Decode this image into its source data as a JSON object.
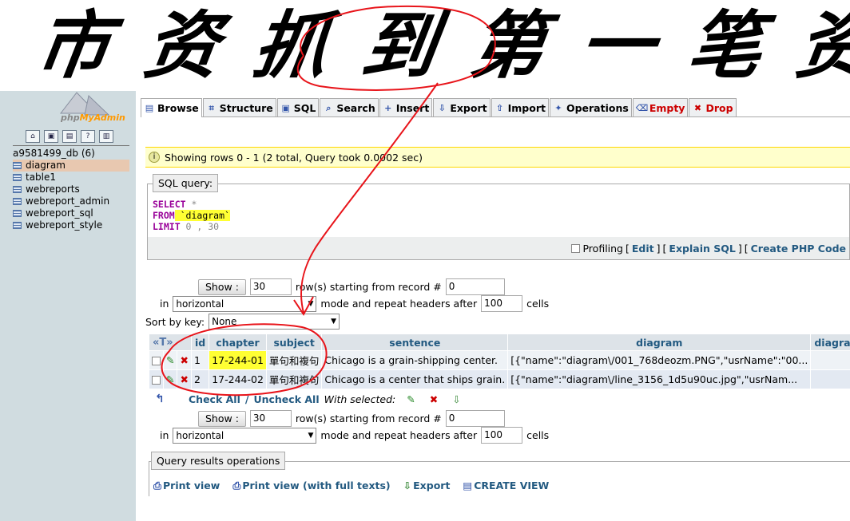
{
  "banner": {
    "handwriting": "市 资 抓 到 第 一 笔 资 料"
  },
  "sidebar": {
    "logo": {
      "part1": "php",
      "part2": "MyAdmin"
    },
    "icons": [
      "home-icon",
      "lock-icon",
      "sql-icon",
      "help-icon",
      "docs-icon"
    ],
    "db": "a9581499_db (6)",
    "tables": [
      "diagram",
      "table1",
      "webreports",
      "webreport_admin",
      "webreport_sql",
      "webreport_style"
    ],
    "active_table": "diagram"
  },
  "tabs": [
    {
      "label": "Browse",
      "icon": "▤"
    },
    {
      "label": "Structure",
      "icon": "⌗"
    },
    {
      "label": "SQL",
      "icon": "▣"
    },
    {
      "label": "Search",
      "icon": "⌕"
    },
    {
      "label": "Insert",
      "icon": "+"
    },
    {
      "label": "Export",
      "icon": "⇩"
    },
    {
      "label": "Import",
      "icon": "⇧"
    },
    {
      "label": "Operations",
      "icon": "✦"
    },
    {
      "label": "Empty",
      "icon": "⌫"
    },
    {
      "label": "Drop",
      "icon": "✖"
    }
  ],
  "notice": "Showing rows 0 - 1 (2 total, Query took 0.0002 sec)",
  "sql_box": {
    "legend": "SQL query:",
    "select_kw": "SELECT",
    "star": " *",
    "from_kw": "FROM",
    "table": " `diagram`",
    "limit_kw": "LIMIT",
    "limit_val": " 0 , 30"
  },
  "sql_bar": {
    "profiling": "Profiling",
    "edit": "Edit",
    "explain": "Explain SQL",
    "php": "Create PHP Code"
  },
  "nav_top": {
    "show_btn": "Show :",
    "rows_value": "30",
    "rows_label": "row(s) starting from record #",
    "start_value": "0",
    "in_label": "in",
    "mode_value": "horizontal",
    "mode_label": "mode and repeat headers after",
    "repeat_value": "100",
    "cells_label": "cells"
  },
  "sort": {
    "label": "Sort by key:",
    "value": "None"
  },
  "table": {
    "headers": [
      "id",
      "chapter",
      "subject",
      "sentence",
      "diagram",
      "diagram_xml"
    ],
    "rows": [
      [
        "1",
        "17-244-01",
        "單句和複句",
        "Chicago is a grain-shipping center.",
        "[{\"name\":\"diagram\\/001_768deozm.PNG\",\"usrName\":\"00...",
        ""
      ],
      [
        "2",
        "17-244-02",
        "單句和複句",
        "Chicago is a center that ships grain.",
        "[{\"name\":\"diagram\\/line_3156_1d5u90uc.jpg\",\"usrNam...",
        ""
      ]
    ]
  },
  "with_selected": {
    "check_all": "Check All",
    "sep": " / ",
    "uncheck_all": "Uncheck All",
    "label": "With selected:"
  },
  "nav_bottom": {
    "show_btn": "Show :",
    "rows_value": "30",
    "rows_label": "row(s) starting from record #",
    "start_value": "0",
    "in_label": "in",
    "mode_value": "horizontal",
    "mode_label": "mode and repeat headers after",
    "repeat_value": "100",
    "cells_label": "cells"
  },
  "qro": {
    "legend": "Query results operations",
    "print": "Print view",
    "print_full": "Print view (with full texts)",
    "export": "Export",
    "create_view": "CREATE VIEW"
  },
  "colors": {
    "annotation": "#e8141a",
    "highlight": "#ffff33",
    "link": "#235a81"
  }
}
